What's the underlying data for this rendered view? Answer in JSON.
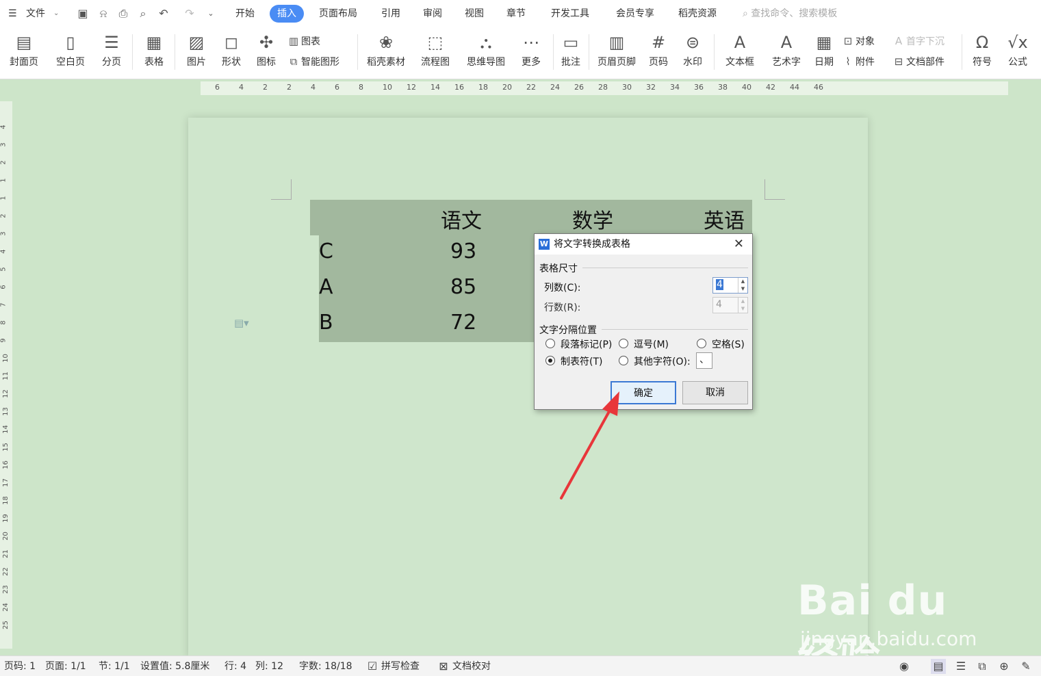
{
  "menubar": {
    "file": "文件",
    "tabs": [
      "开始",
      "插入",
      "页面布局",
      "引用",
      "审阅",
      "视图",
      "章节",
      "开发工具",
      "会员专享",
      "稻壳资源"
    ],
    "active_tab": "插入",
    "search_placeholder": "查找命令、搜索模板"
  },
  "ribbon": {
    "items": [
      "封面页",
      "空白页",
      "分页",
      "表格",
      "图片",
      "形状",
      "图标",
      "稻壳素材",
      "流程图",
      "思维导图",
      "更多",
      "批注",
      "页眉页脚",
      "页码",
      "水印",
      "文本框",
      "艺术字",
      "日期",
      "符号",
      "公式"
    ],
    "small": {
      "chart": "图表",
      "smartart": "智能图形",
      "object": "对象",
      "dropcap": "首字下沉",
      "attachment": "附件",
      "docparts": "文档部件"
    }
  },
  "ruler": {
    "h_ticks": [
      "6",
      "4",
      "2",
      "2",
      "4",
      "6",
      "8",
      "10",
      "12",
      "14",
      "16",
      "18",
      "20",
      "22",
      "24",
      "26",
      "28",
      "30",
      "32",
      "34",
      "36",
      "38",
      "40",
      "42",
      "44",
      "46"
    ],
    "v_ticks": [
      "4",
      "3",
      "2",
      "1",
      "1",
      "2",
      "3",
      "4",
      "5",
      "6",
      "7",
      "8",
      "9",
      "10",
      "11",
      "12",
      "13",
      "14",
      "15",
      "16",
      "17",
      "18",
      "19",
      "20",
      "21",
      "22",
      "23",
      "24",
      "25"
    ]
  },
  "document": {
    "header": [
      "语文",
      "数学",
      "英语"
    ],
    "rows": [
      {
        "name": "C",
        "score": "93"
      },
      {
        "name": "A",
        "score": "85"
      },
      {
        "name": "B",
        "score": "72"
      }
    ]
  },
  "dialog": {
    "title": "将文字转换成表格",
    "size_group": "表格尺寸",
    "cols_label": "列数(C):",
    "cols_value": "4",
    "rows_label": "行数(R):",
    "rows_value": "4",
    "sep_group": "文字分隔位置",
    "radio_para": "段落标记(P)",
    "radio_comma": "逗号(M)",
    "radio_space": "空格(S)",
    "radio_tab": "制表符(T)",
    "radio_other": "其他字符(O):",
    "other_value": "、",
    "ok": "确定",
    "cancel": "取消"
  },
  "status": {
    "page_num": "页码: 1",
    "page": "页面: 1/1",
    "section": "节: 1/1",
    "setting": "设置值: 5.8厘米",
    "row": "行: 4",
    "col": "列: 12",
    "words": "字数: 18/18",
    "spell": "拼写检查",
    "proof": "文档校对"
  },
  "watermark": {
    "brand": "Bai du 经验",
    "url": "jingyan.baidu.com"
  },
  "colors": {
    "accent": "#4a8cf4",
    "page_bg": "#cde5c9",
    "selection": "#a2b89e",
    "arrow": "#e8363a"
  }
}
